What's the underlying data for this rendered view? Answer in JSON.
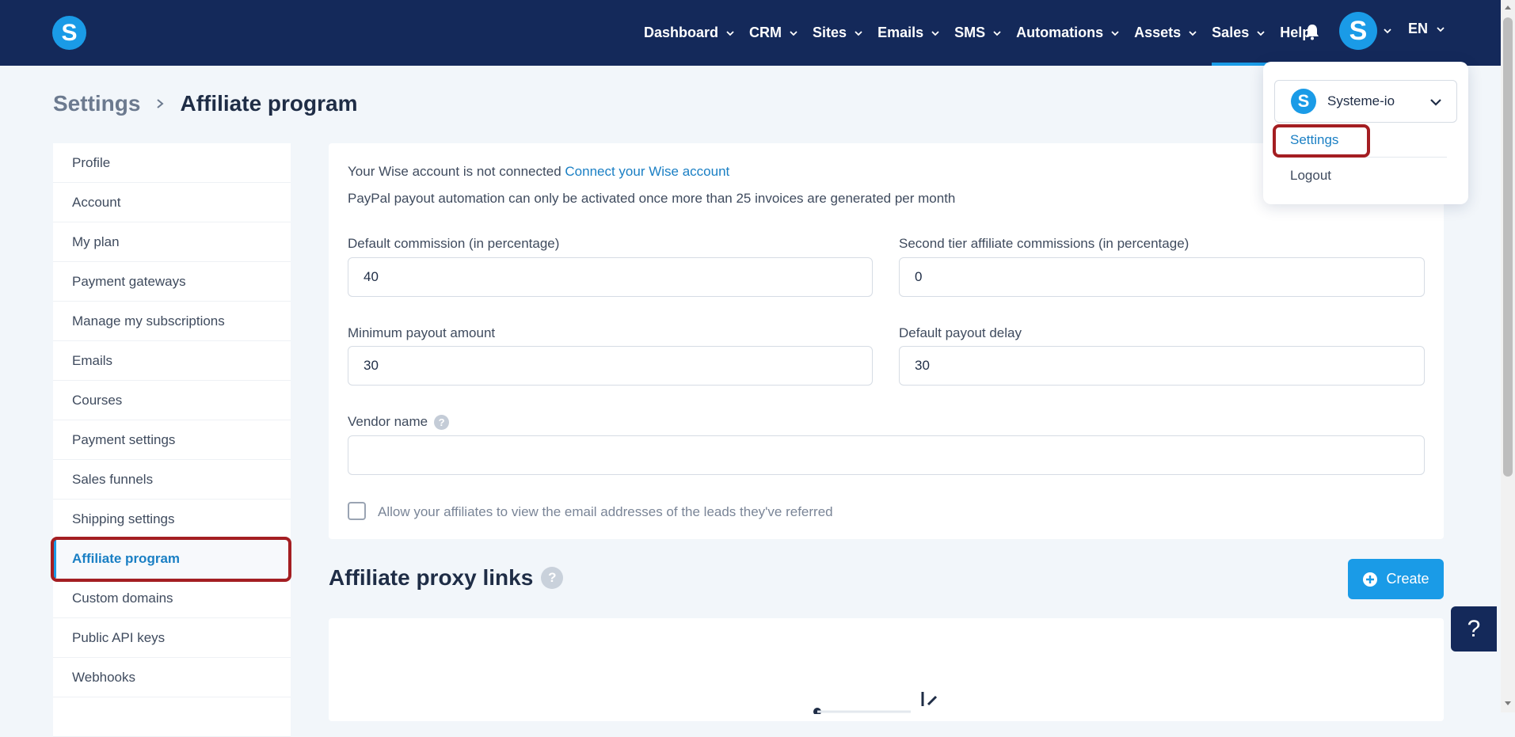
{
  "brand": {
    "logo_letter": "S",
    "accent": "#1a9be7",
    "nav_bg": "#14295a",
    "highlight": "#a41e22"
  },
  "nav": {
    "items": [
      {
        "label": "Dashboard",
        "has_menu": true
      },
      {
        "label": "CRM",
        "has_menu": true
      },
      {
        "label": "Sites",
        "has_menu": true
      },
      {
        "label": "Emails",
        "has_menu": true
      },
      {
        "label": "SMS",
        "has_menu": true
      },
      {
        "label": "Automations",
        "has_menu": true
      },
      {
        "label": "Assets",
        "has_menu": true
      },
      {
        "label": "Sales",
        "has_menu": true,
        "active": true
      },
      {
        "label": "Help",
        "has_menu": false
      }
    ],
    "avatar_letter": "S",
    "language": "EN"
  },
  "breadcrumb": {
    "root": "Settings",
    "current": "Affiliate program"
  },
  "sidebar": {
    "items": [
      {
        "label": "Profile"
      },
      {
        "label": "Account"
      },
      {
        "label": "My plan"
      },
      {
        "label": "Payment gateways"
      },
      {
        "label": "Manage my subscriptions"
      },
      {
        "label": "Emails"
      },
      {
        "label": "Courses"
      },
      {
        "label": "Payment settings"
      },
      {
        "label": "Sales funnels"
      },
      {
        "label": "Shipping settings"
      },
      {
        "label": "Affiliate program",
        "active": true
      },
      {
        "label": "Custom domains"
      },
      {
        "label": "Public API keys"
      },
      {
        "label": "Webhooks"
      }
    ]
  },
  "settings_form": {
    "wise_status": "Your Wise account is not connected",
    "wise_link": "Connect your Wise account",
    "paypal_note": "PayPal payout automation can only be activated once more than 25 invoices are generated per month",
    "default_commission": {
      "label": "Default commission (in percentage)",
      "value": "40"
    },
    "second_tier": {
      "label": "Second tier affiliate commissions (in percentage)",
      "value": "0"
    },
    "min_payout": {
      "label": "Minimum payout amount",
      "value": "30"
    },
    "payout_delay": {
      "label": "Default payout delay",
      "value": "30"
    },
    "vendor_name": {
      "label": "Vendor name",
      "value": "",
      "help": "?"
    },
    "show_emails_checkbox": {
      "label": "Allow your affiliates to view the email addresses of the leads they've referred",
      "checked": false
    }
  },
  "proxy_links": {
    "title": "Affiliate proxy links",
    "help": "?",
    "create_label": "Create"
  },
  "user_menu": {
    "account_name": "Systeme-io",
    "account_logo_letter": "S",
    "settings_label": "Settings",
    "logout_label": "Logout"
  },
  "help_button": "?"
}
